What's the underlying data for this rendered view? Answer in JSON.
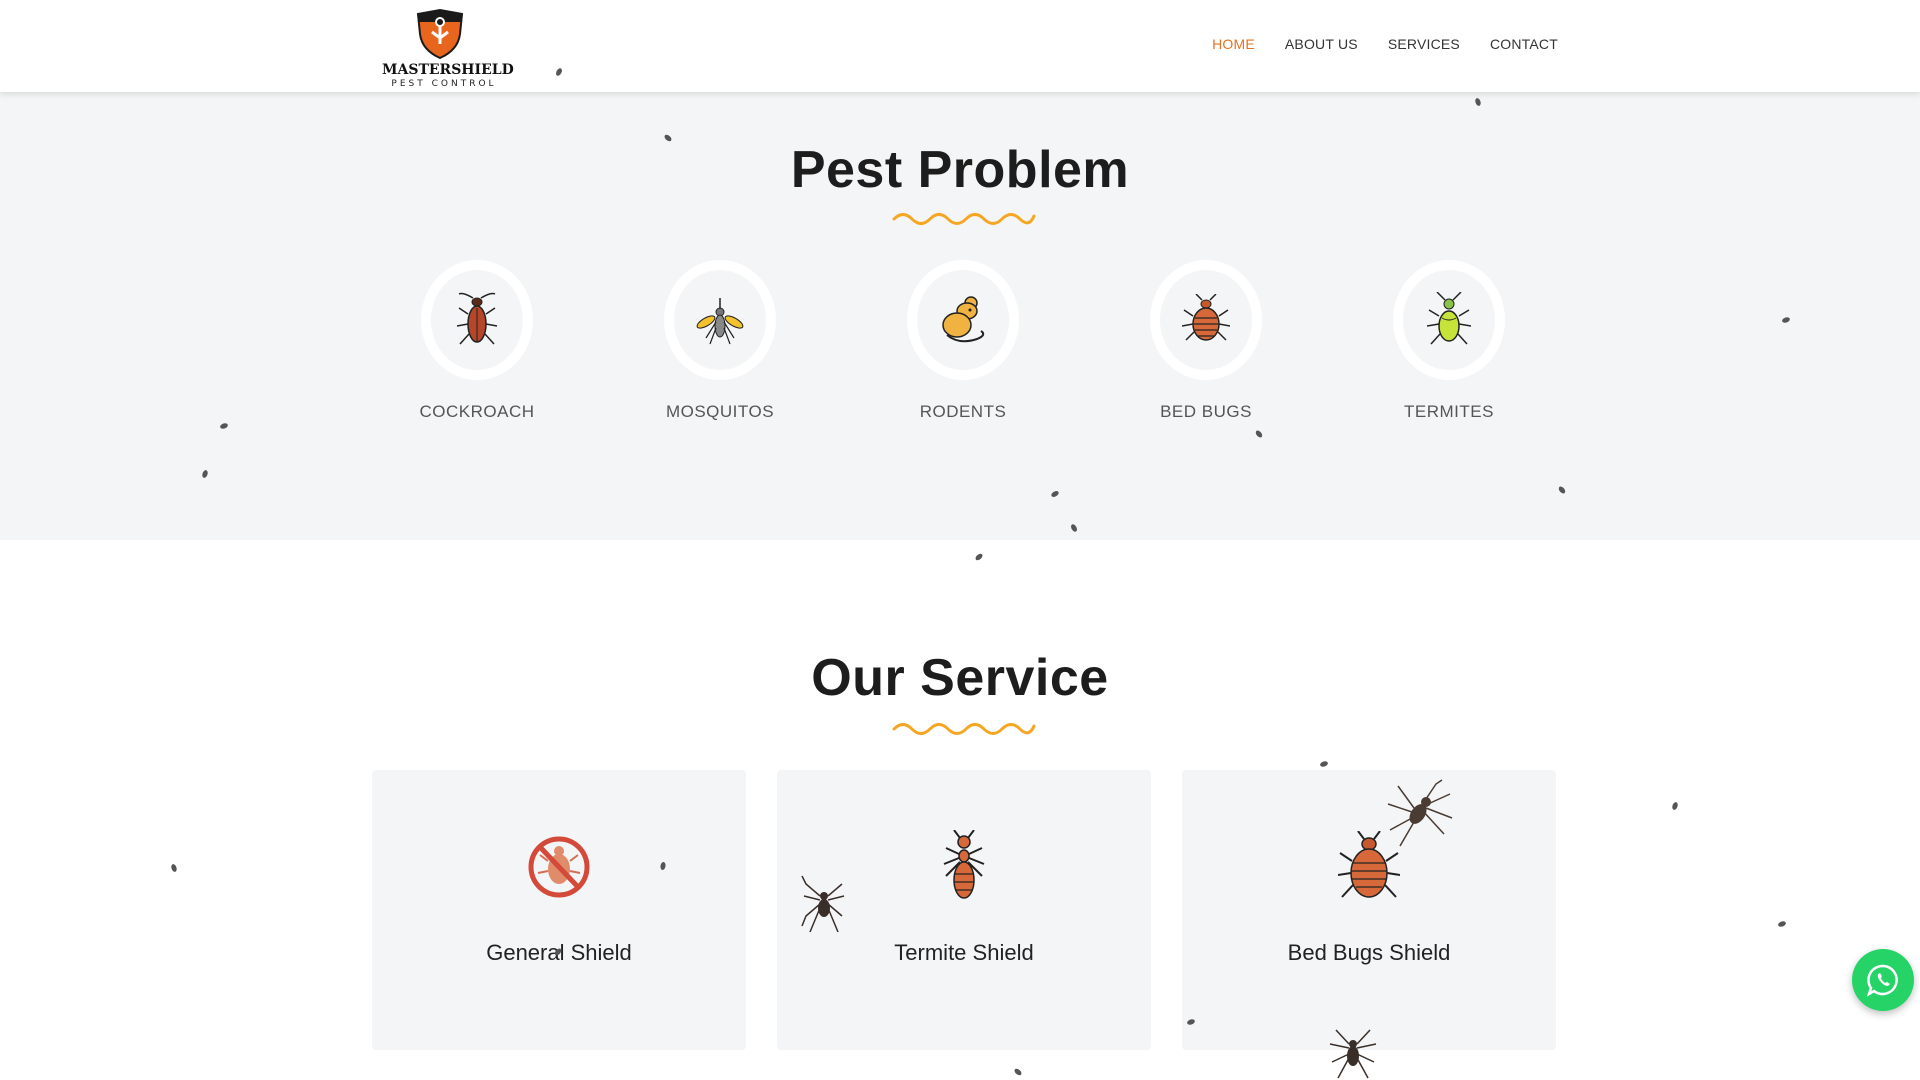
{
  "brand": {
    "name": "MASTERSHIELD",
    "tagline": "PEST CONTROL",
    "accent_color": "#e27322",
    "squiggle_color": "#f5a623"
  },
  "nav": {
    "items": [
      {
        "label": "HOME",
        "active": true
      },
      {
        "label": "ABOUT US",
        "active": false
      },
      {
        "label": "SERVICES",
        "active": false
      },
      {
        "label": "CONTACT",
        "active": false
      }
    ]
  },
  "pest_problem": {
    "title": "Pest Problem",
    "items": [
      {
        "label": "COCKROACH",
        "icon": "cockroach-icon"
      },
      {
        "label": "MOSQUITOS",
        "icon": "mosquito-icon"
      },
      {
        "label": "RODENTS",
        "icon": "rodent-icon"
      },
      {
        "label": "BED BUGS",
        "icon": "bed-bug-icon"
      },
      {
        "label": "TERMITES",
        "icon": "termite-icon"
      }
    ]
  },
  "services": {
    "title": "Our Service",
    "items": [
      {
        "title": "General Shield",
        "icon": "no-bug-icon"
      },
      {
        "title": "Termite Shield",
        "icon": "termite-icon"
      },
      {
        "title": "Bed Bugs Shield",
        "icon": "bed-bug-icon"
      }
    ]
  },
  "whatsapp": {
    "icon": "whatsapp-icon",
    "color": "#25d366"
  }
}
